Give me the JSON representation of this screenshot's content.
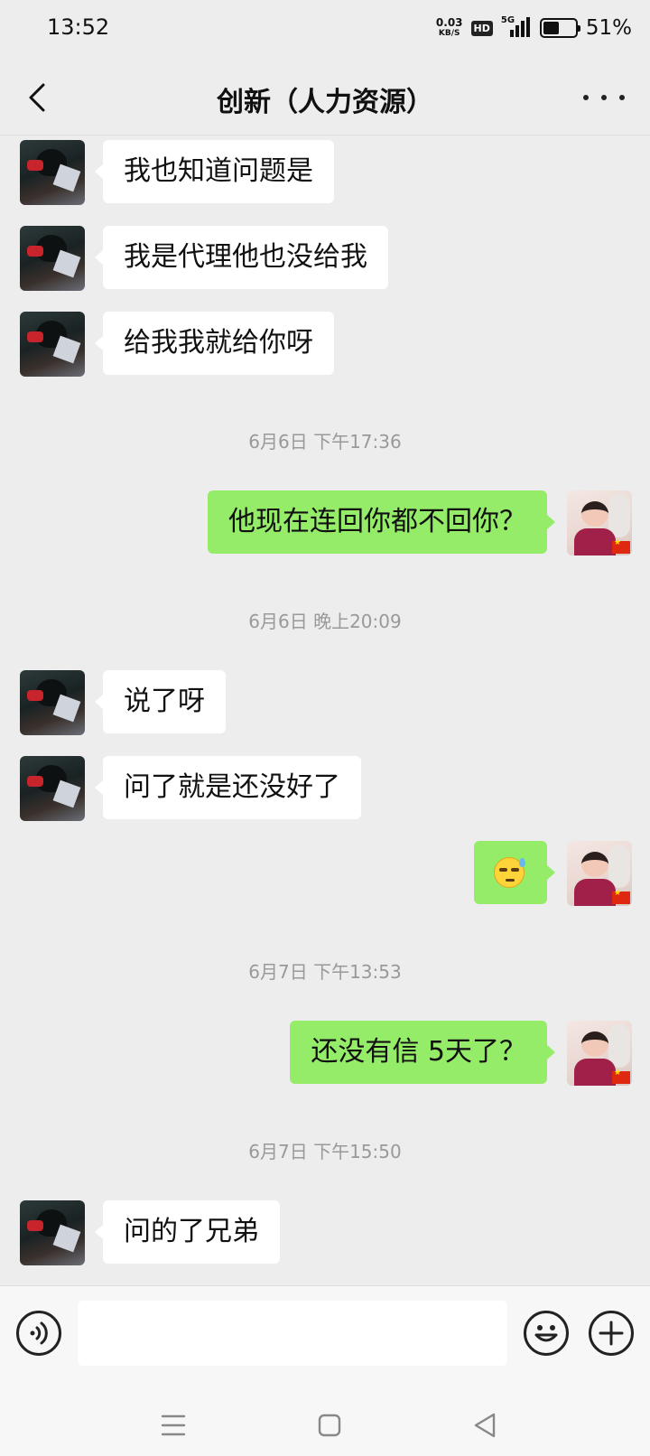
{
  "status_bar": {
    "time": "13:52",
    "net_speed": "0.03",
    "net_unit": "KB/S",
    "hd": "HD",
    "network": "5G",
    "battery_level": 0.51,
    "battery_text": "51%"
  },
  "header": {
    "title": "创新（人力资源）",
    "back_icon": "chevron-left-icon",
    "more_icon": "more-dots-icon"
  },
  "messages": [
    {
      "type": "received",
      "text": "我也知道问题是"
    },
    {
      "type": "received",
      "text": "我是代理他也没给我"
    },
    {
      "type": "received",
      "text": "给我我就给你呀"
    },
    {
      "type": "time",
      "text": "6月6日 下午17:36"
    },
    {
      "type": "sent",
      "text": "他现在连回你都不回你？"
    },
    {
      "type": "time",
      "text": "6月6日 晚上20:09"
    },
    {
      "type": "received",
      "text": "说了呀"
    },
    {
      "type": "received",
      "text": "问了就是还没好了"
    },
    {
      "type": "sent",
      "emoji": "sweat-emoji"
    },
    {
      "type": "time",
      "text": "6月7日 下午13:53"
    },
    {
      "type": "sent",
      "text": "还没有信 5天了？"
    },
    {
      "type": "time",
      "text": "6月7日 下午15:50"
    },
    {
      "type": "received",
      "text": "问的了兄弟"
    }
  ],
  "input_bar": {
    "voice_icon": "voice-icon",
    "text_value": "",
    "emoji_icon": "emoji-icon",
    "plus_icon": "plus-icon"
  },
  "nav_bar": {
    "menu_icon": "menu-icon",
    "home_icon": "home-icon",
    "back_icon": "back-triangle-icon"
  },
  "colors": {
    "background": "#ededed",
    "sent_bubble": "#95ec69",
    "received_bubble": "#ffffff",
    "timestamp": "#999999"
  }
}
